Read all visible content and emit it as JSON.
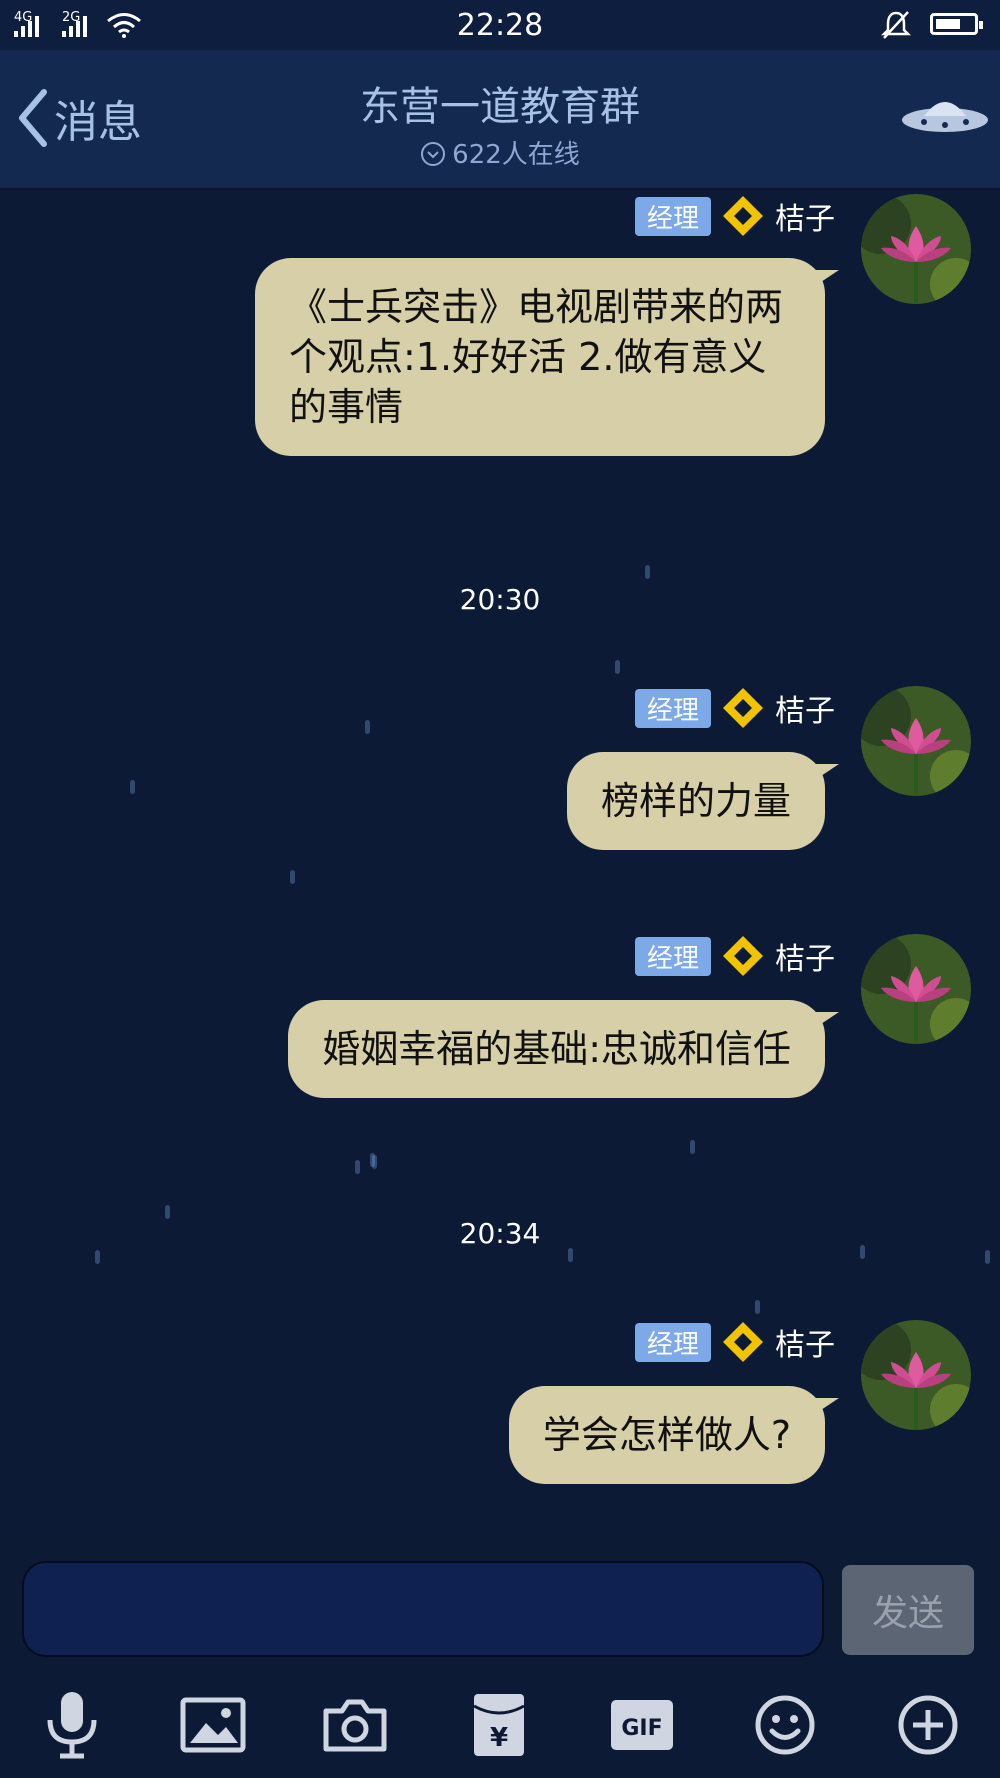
{
  "status_bar": {
    "net1": "4G",
    "net2": "2G",
    "time": "22:28"
  },
  "header": {
    "back_label": "消息",
    "title": "东营一道教育群",
    "online": "622人在线"
  },
  "messages": [
    {
      "role": "经理",
      "sender": "桔子",
      "text": "《士兵突击》电视剧带来的两个观点:1.好好活  2.做有意义的事情"
    },
    {
      "role": "经理",
      "sender": "桔子",
      "text": "榜样的力量"
    },
    {
      "role": "经理",
      "sender": "桔子",
      "text": "婚姻幸福的基础:忠诚和信任"
    },
    {
      "role": "经理",
      "sender": "桔子",
      "text": "学会怎样做人?"
    }
  ],
  "timestamps": [
    "20:30",
    "20:34"
  ],
  "input": {
    "value": "",
    "send_label": "发送"
  },
  "toolbar": {
    "gif_label": "GIF"
  },
  "colors": {
    "background": "#0c1a35",
    "bubble": "#d7cfa7",
    "badge": "#7da9e8"
  },
  "icons": [
    "microphone-icon",
    "image-icon",
    "camera-icon",
    "red-packet-icon",
    "gif-icon",
    "emoji-icon",
    "plus-icon"
  ]
}
